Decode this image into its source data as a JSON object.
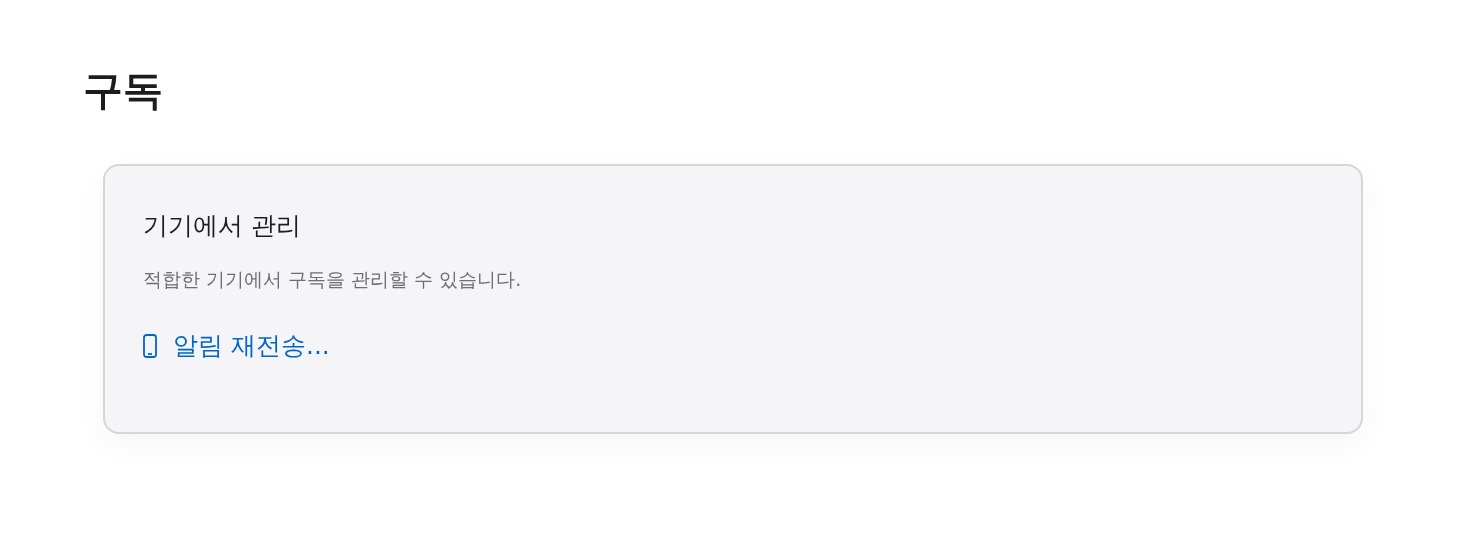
{
  "page": {
    "title": "구독"
  },
  "card": {
    "title": "기기에서 관리",
    "description": "적합한 기기에서 구독을 관리할 수 있습니다.",
    "link": "알림 재전송..."
  }
}
